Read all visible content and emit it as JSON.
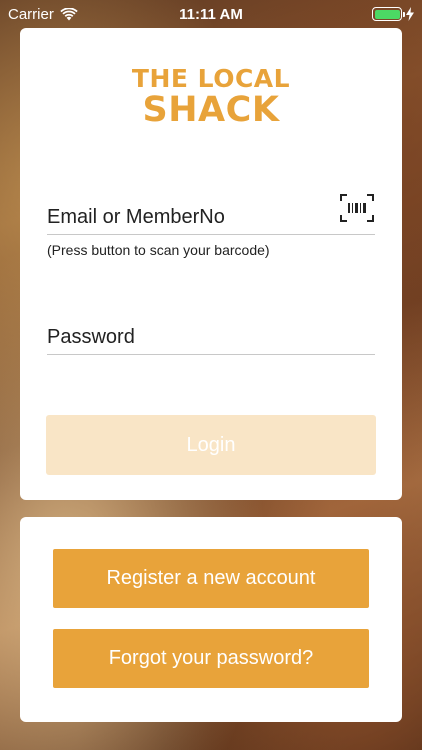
{
  "status_bar": {
    "carrier": "Carrier",
    "time": "11:11 AM",
    "battery_color": "#4cd964"
  },
  "logo": {
    "line1": "THE LOCAL",
    "line2": "SHACK",
    "color": "#e8a33a"
  },
  "login_form": {
    "email_placeholder": "Email or MemberNo",
    "email_value": "",
    "barcode_icon": "barcode-scan-icon",
    "hint": "(Press button to scan your barcode)",
    "password_placeholder": "Password",
    "password_value": "",
    "login_label": "Login"
  },
  "actions": {
    "register_label": "Register a new account",
    "forgot_label": "Forgot your password?"
  },
  "colors": {
    "accent": "#e8a33a",
    "login_disabled": "#f9e5c6"
  }
}
